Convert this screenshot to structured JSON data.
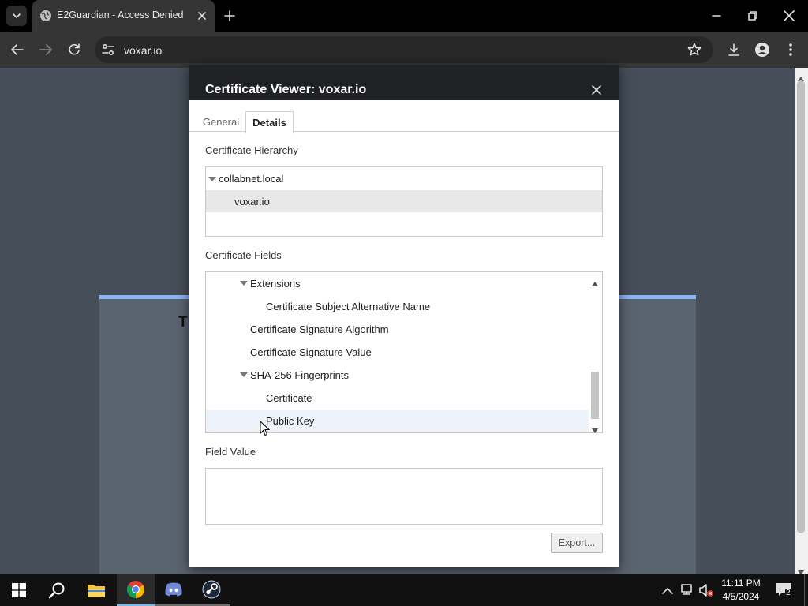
{
  "browser": {
    "tab_title": "E2Guardian - Access Denied",
    "url": "voxar.io"
  },
  "page": {
    "card_heading_fragment": "T"
  },
  "dialog": {
    "title": "Certificate Viewer: voxar.io",
    "tabs": [
      {
        "label": "General",
        "active": false
      },
      {
        "label": "Details",
        "active": true
      }
    ],
    "hierarchy_label": "Certificate Hierarchy",
    "hierarchy": [
      {
        "label": "collabnet.local",
        "expanded": true
      },
      {
        "label": "voxar.io",
        "selected": true
      }
    ],
    "fields_label": "Certificate Fields",
    "fields": [
      {
        "label": "Extensions",
        "expandable": true
      },
      {
        "label": "Certificate Subject Alternative Name"
      },
      {
        "label": "Certificate Signature Algorithm"
      },
      {
        "label": "Certificate Signature Value"
      },
      {
        "label": "SHA-256 Fingerprints",
        "expandable": true
      },
      {
        "label": "Certificate"
      },
      {
        "label": "Public Key",
        "hovered": true
      }
    ],
    "field_value_label": "Field Value",
    "field_value": "",
    "export_label": "Export..."
  },
  "taskbar": {
    "time": "11:11 PM",
    "date": "4/5/2024",
    "notification_count": "2"
  },
  "colors": {
    "accent_blue": "#8ab4f8",
    "page_bg": "#464e59",
    "dialog_header": "#202124"
  }
}
